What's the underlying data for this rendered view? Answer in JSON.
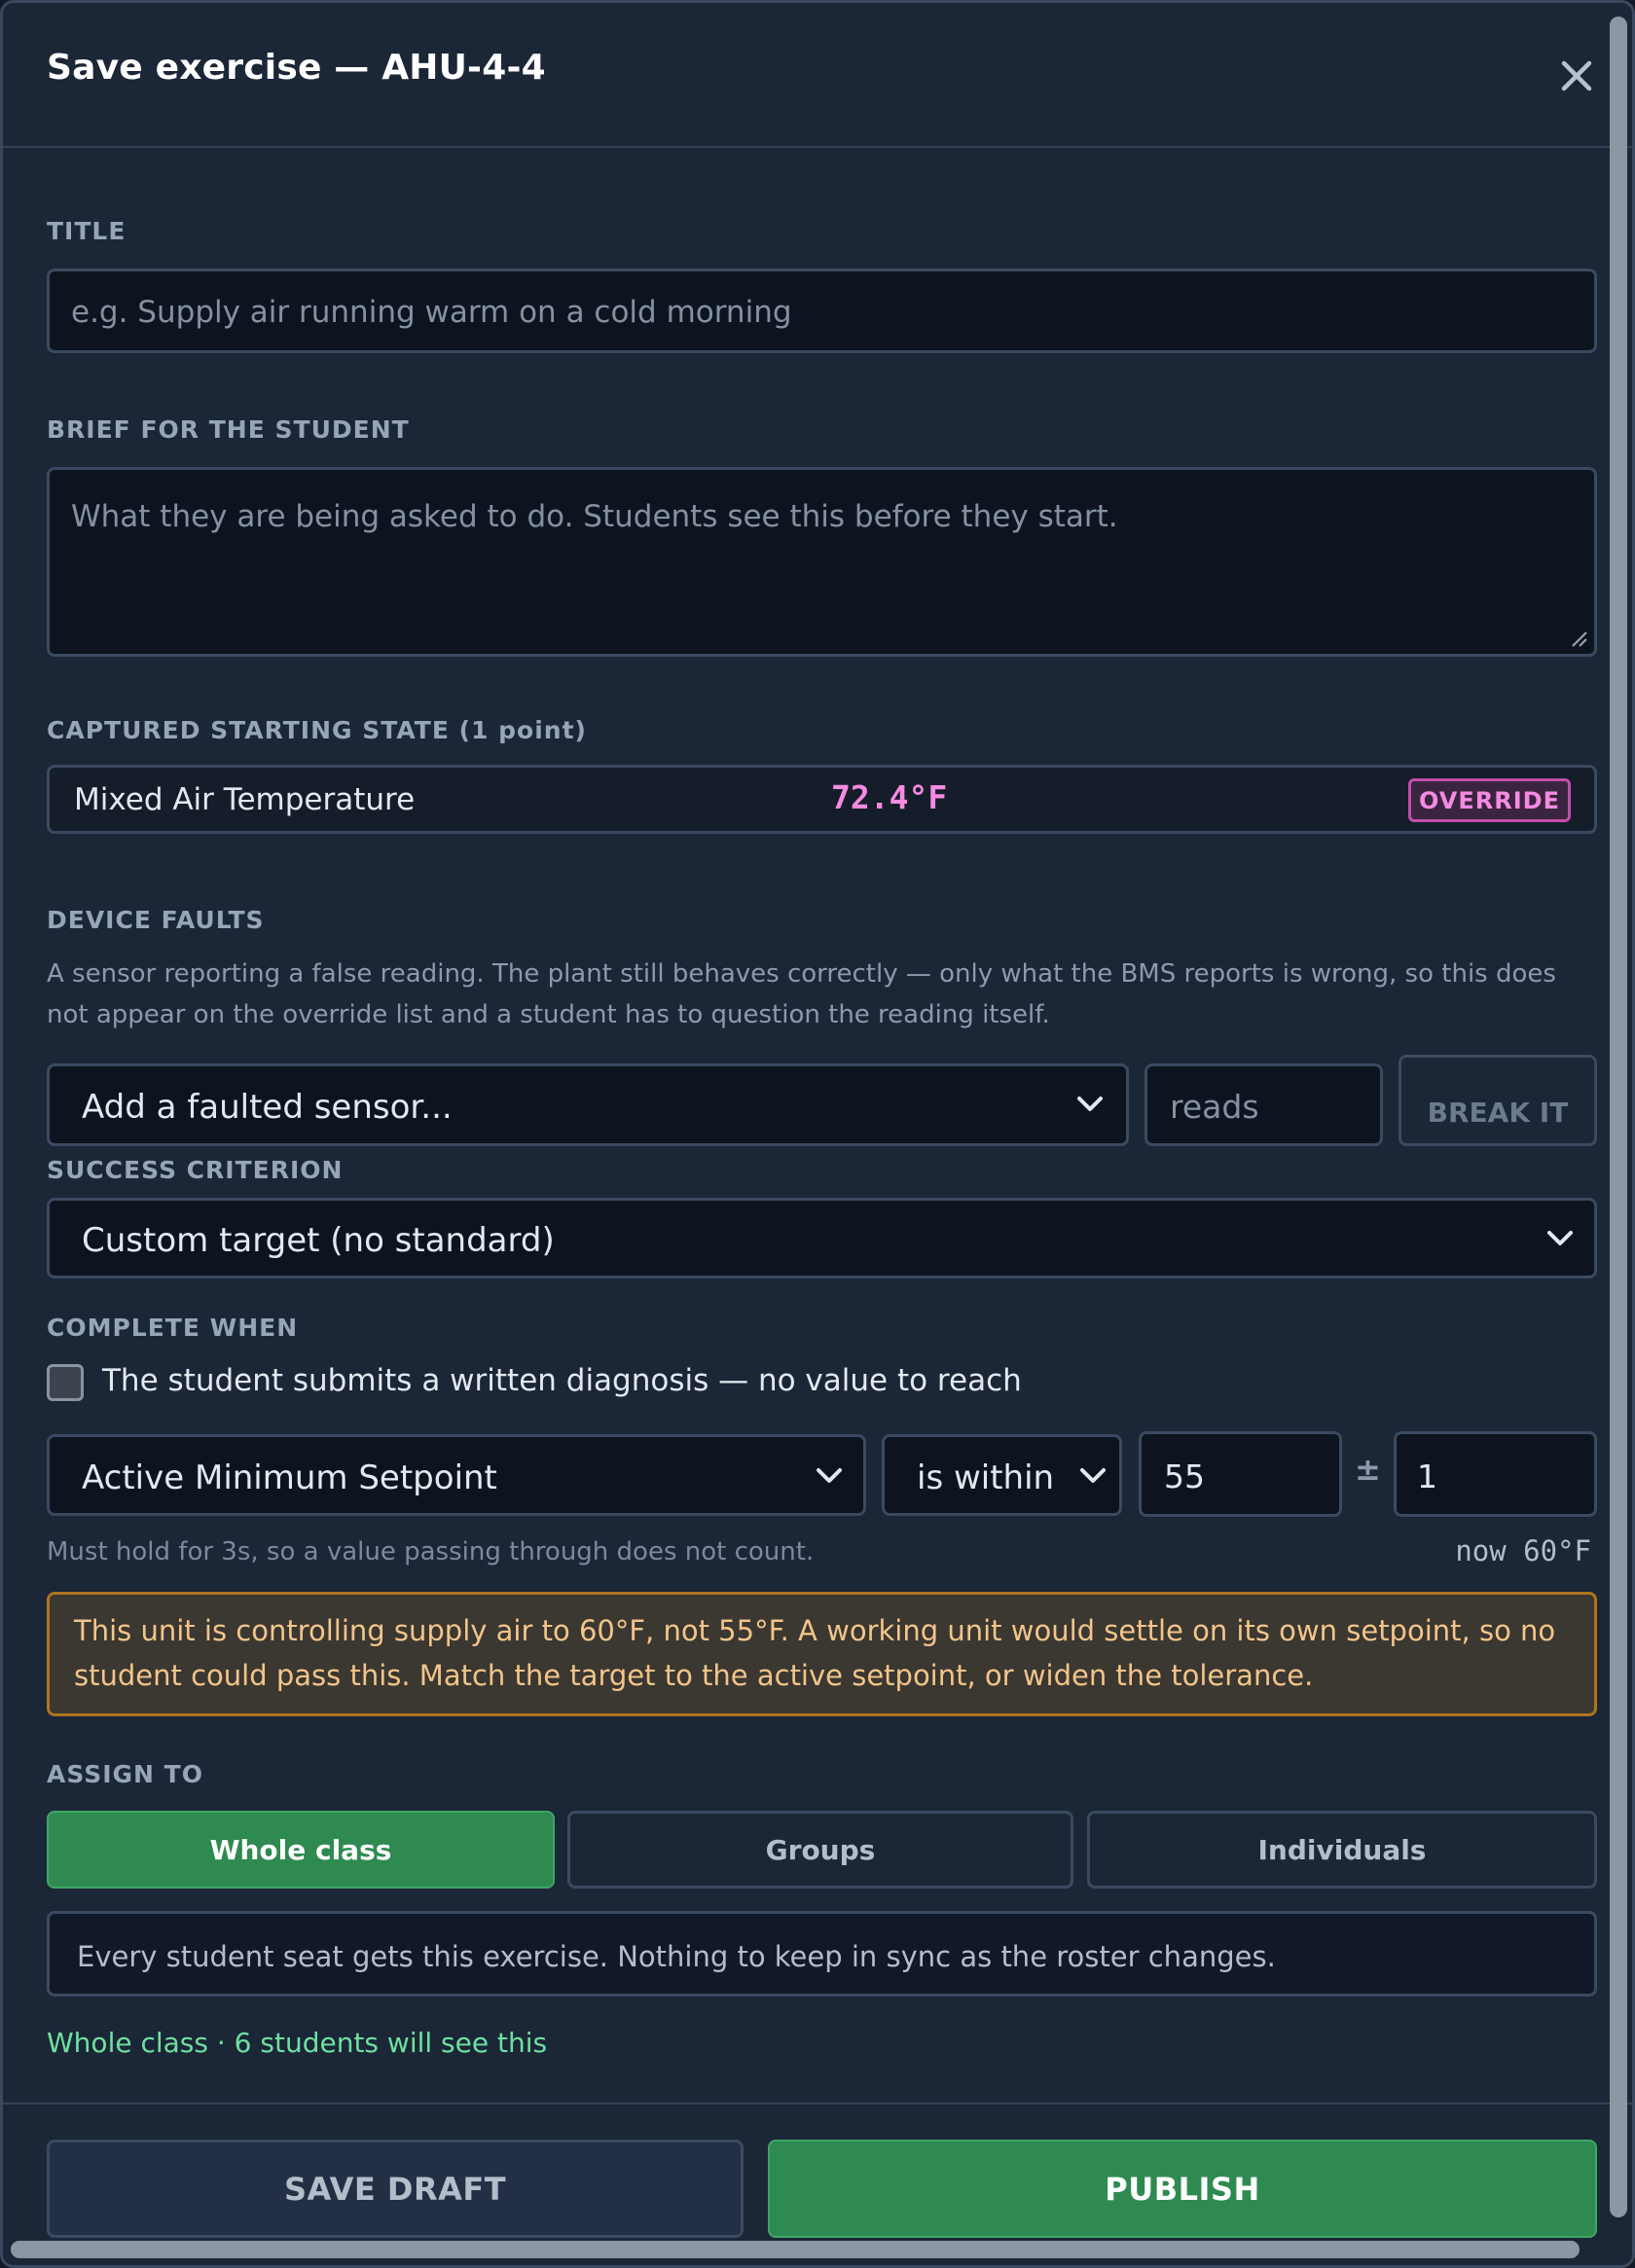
{
  "dialog": {
    "title": "Save exercise — AHU-4-4",
    "close_icon": "close-icon"
  },
  "title_section": {
    "label": "TITLE",
    "placeholder": "e.g. Supply air running warm on a cold morning"
  },
  "brief_section": {
    "label": "BRIEF FOR THE STUDENT",
    "placeholder": "What they are being asked to do. Students see this before they start."
  },
  "starting_state": {
    "label": "CAPTURED STARTING STATE (1 point)",
    "point_name": "Mixed Air Temperature",
    "point_value": "72.4°F",
    "badge": "OVERRIDE",
    "value_color": "#f58ae0"
  },
  "device_faults": {
    "label": "DEVICE FAULTS",
    "description": "A sensor reporting a false reading. The plant still behaves correctly — only what the BMS reports is wrong, so this does not appear on the override list and a student has to question the reading itself.",
    "sensor_select": "Add a faulted sensor...",
    "reads_placeholder": "reads",
    "break_button": "BREAK IT"
  },
  "success_criterion": {
    "label": "SUCCESS CRITERION",
    "selected": "Custom target (no standard)"
  },
  "complete_when": {
    "label": "COMPLETE WHEN",
    "checkbox_label": "The student submits a written diagnosis — no value to reach",
    "checkbox_checked": false,
    "point": "Active Minimum Setpoint",
    "operator": "is within",
    "target": "55",
    "plus_minus": "±",
    "tolerance": "1",
    "hold_note": "Must hold for 3s, so a value passing through does not count.",
    "now_value": "now 60°F"
  },
  "warning": {
    "text": "This unit is controlling supply air to 60°F, not 55°F. A working unit would settle on its own setpoint, so no student could pass this. Match the target to the active setpoint, or widen the tolerance.",
    "color": "#f2c58a"
  },
  "assign_to": {
    "label": "ASSIGN TO",
    "options": [
      "Whole class",
      "Groups",
      "Individuals"
    ],
    "selected": "Whole class",
    "description": "Every student seat gets this exercise. Nothing to keep in sync as the roster changes.",
    "summary": "Whole class · 6 students will see this",
    "accent": "#2e8a50"
  },
  "footer": {
    "save_draft": "SAVE DRAFT",
    "publish": "PUBLISH"
  }
}
